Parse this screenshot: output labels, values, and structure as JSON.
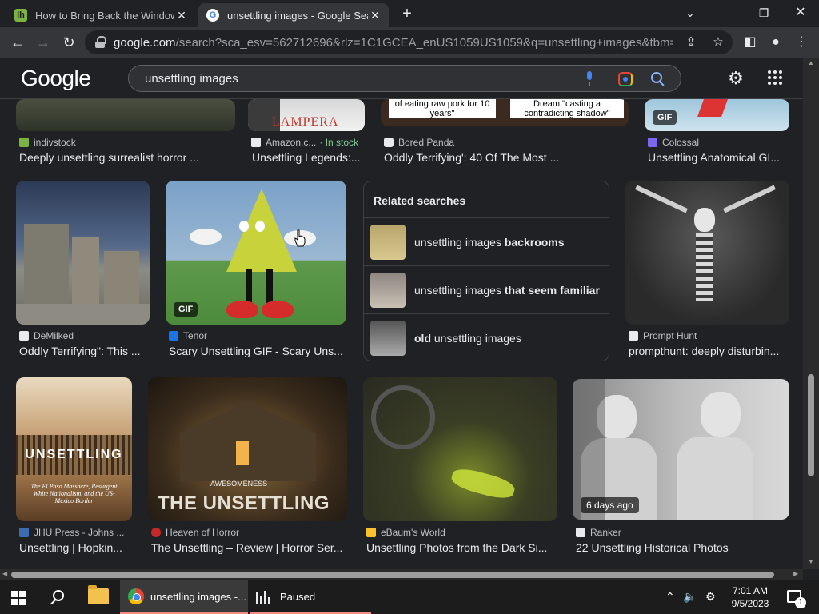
{
  "browser": {
    "tabs": [
      {
        "title": "How to Bring Back the Windows",
        "favicon": "lh-favicon"
      },
      {
        "title": "unsettling images - Google Search",
        "favicon": "google-favicon",
        "active": true
      }
    ],
    "url_host": "google.com",
    "url_path": "/search?sca_esv=562712696&rlz=1C1GCEA_enUS1059US1059&q=unsettling+images&tbm=isch&s..."
  },
  "google": {
    "logo": "Google",
    "query": "unsettling images"
  },
  "results_top": [
    {
      "source": "indivstock",
      "caption": "Deeply unsettling surrealist horror ...",
      "thumb_text": ""
    },
    {
      "source": "Amazon.c...",
      "stock": "· In stock",
      "caption": "Unsettling Legends:...",
      "thumb_text": "LAMPERA"
    },
    {
      "source": "Bored Panda",
      "caption": "Oddly Terrifying': 40 Of The Most ...",
      "thumb_text_a": "of eating raw pork for 10 years\"",
      "thumb_text_b": "Dream \"casting a contradicting shadow\""
    },
    {
      "source": "Colossal",
      "caption": "Unsettling Anatomical GI...",
      "badge": "GIF"
    }
  ],
  "results_mid": [
    {
      "source": "DeMilked",
      "caption": "Oddly Terrifying\": This ..."
    },
    {
      "source": "Tenor",
      "caption": "Scary Unsettling GIF - Scary Uns...",
      "badge": "GIF"
    },
    {
      "source": "Prompt Hunt",
      "caption": "prompthunt: deeply disturbin..."
    }
  ],
  "related": {
    "heading": "Related searches",
    "items": [
      {
        "pre": "unsettling images ",
        "bold": "backrooms",
        "post": ""
      },
      {
        "pre": "unsettling images ",
        "bold": "that seem familiar",
        "post": ""
      },
      {
        "pre": "",
        "bold": "old",
        "post": " unsettling images"
      }
    ]
  },
  "results_bottom": [
    {
      "source": "JHU Press - Johns ...",
      "caption": "Unsettling | Hopkin...",
      "cover_title": "UNSETTLING",
      "cover_sub": "The El Paso Massacre, Resurgent White Nationalism, and the US-Mexico Border"
    },
    {
      "source": "Heaven of Horror",
      "caption": "The Unsettling – Review | Horror Ser...",
      "cover_small": "AWESOMENESS",
      "cover_title": "THE UNSETTLING"
    },
    {
      "source": "eBaum's World",
      "caption": "Unsettling Photos from the Dark Si..."
    },
    {
      "source": "Ranker",
      "caption": "22 Unsettling Historical Photos",
      "badge": "6 days ago"
    }
  ],
  "taskbar": {
    "chrome_label": "unsettling images -...",
    "paused_label": "Paused",
    "time": "7:01 AM",
    "date": "9/5/2023",
    "notifications": "1"
  },
  "colors": {
    "accent": "#8ab4f8",
    "bg": "#202124",
    "stock": "#81c995"
  }
}
